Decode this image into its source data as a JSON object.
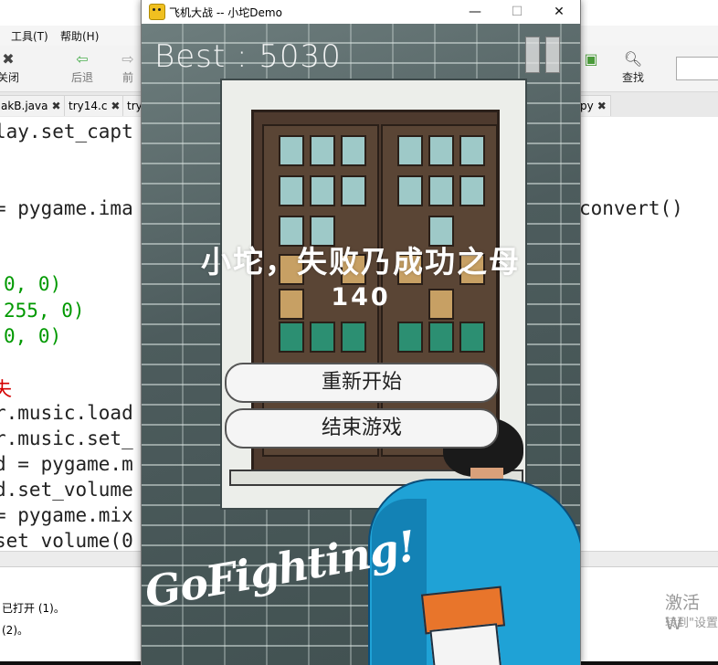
{
  "editor": {
    "menu": [
      "工具(T)",
      "帮助(H)"
    ],
    "toolbar": {
      "close_label": "关闭",
      "back_label": "后退",
      "back_partial_label": "前",
      "find_label": "查找"
    },
    "tabs": [
      "akB.java",
      "try14.c",
      "try",
      "py"
    ],
    "code_lines": [
      "lay.set_capt",
      "= pygame.ima",
      "convert()",
      "0, 0)",
      "255, 0)",
      "0, 0)",
      "失",
      "r.music.load",
      "r.music.set_",
      "d = pygame.m",
      "d.set_volume",
      "= pygame.mix",
      "set_volume(0"
    ],
    "output_lines": [
      "已打开 (1)。",
      "(2)。"
    ],
    "activate_title": "激活 W",
    "activate_sub": "转到\"设置"
  },
  "window": {
    "title": "飞机大战 -- 小坨Demo",
    "min_icon": "—",
    "max_icon": "☐",
    "close_icon": "✕"
  },
  "game": {
    "best_text": "Best : 5030",
    "over_title": "小坨，失败乃成功之母",
    "score": "140",
    "restart_label": "重新开始",
    "quit_label": "结束游戏",
    "slogan": "GoFighting!"
  },
  "colors": {
    "hoodie": "#1fa2d6",
    "brick": "#5d6b6b",
    "code_number": "#009900",
    "code_comment": "#d40000"
  }
}
